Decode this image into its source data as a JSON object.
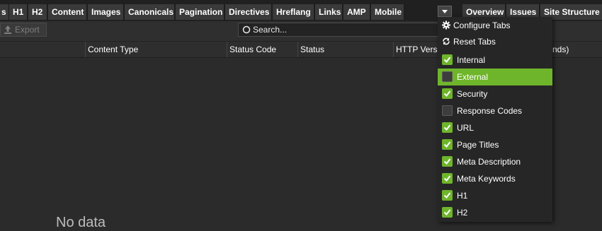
{
  "tabs": [
    {
      "label": "s"
    },
    {
      "label": "H1"
    },
    {
      "label": "H2"
    },
    {
      "label": "Content"
    },
    {
      "label": "Images"
    },
    {
      "label": "Canonicals"
    },
    {
      "label": "Pagination"
    },
    {
      "label": "Directives"
    },
    {
      "label": "Hreflang"
    },
    {
      "label": "Links"
    },
    {
      "label": "AMP"
    },
    {
      "label": "Mobile"
    }
  ],
  "right_tabs": [
    {
      "label": "Overview"
    },
    {
      "label": "Issues"
    },
    {
      "label": "Site Structure"
    }
  ],
  "toolbar": {
    "export_label": "Export",
    "search_placeholder": "Search..."
  },
  "columns": [
    "Content Type",
    "Status Code",
    "Status",
    "HTTP Versi",
    "nds)"
  ],
  "table": {
    "empty_text": "No data"
  },
  "menu": {
    "configure_label": "Configure Tabs",
    "reset_label": "Reset Tabs",
    "items": [
      {
        "label": "Internal",
        "checked": true
      },
      {
        "label": "External",
        "checked": false,
        "highlighted": true
      },
      {
        "label": "Security",
        "checked": true
      },
      {
        "label": "Response Codes",
        "checked": false
      },
      {
        "label": "URL",
        "checked": true
      },
      {
        "label": "Page Titles",
        "checked": true
      },
      {
        "label": "Meta Description",
        "checked": true
      },
      {
        "label": "Meta Keywords",
        "checked": true
      },
      {
        "label": "H1",
        "checked": true
      },
      {
        "label": "H2",
        "checked": true
      }
    ]
  },
  "colors": {
    "accent": "#6fb52b",
    "background": "#2b2b2b",
    "tab_bg": "#3a3a3a"
  },
  "icons": {
    "configure": "gear-icon",
    "reset": "refresh-icon",
    "export": "upload-icon",
    "search": "search-icon",
    "menu_toggle": "chevron-down-icon"
  }
}
